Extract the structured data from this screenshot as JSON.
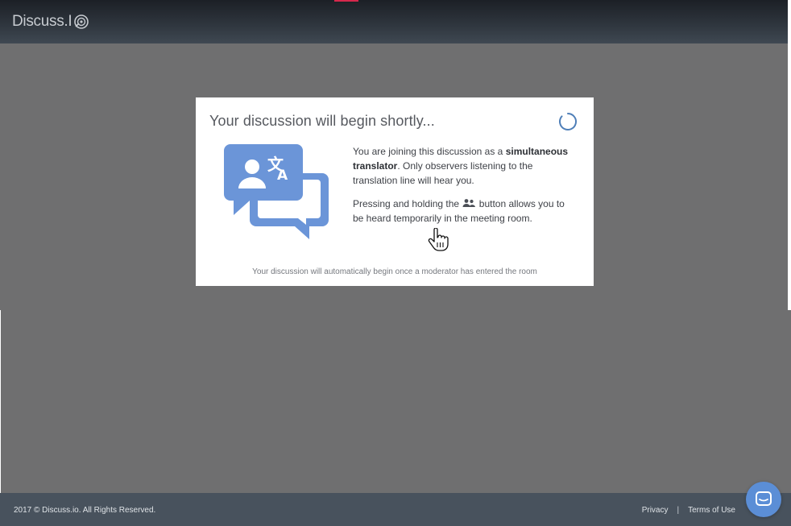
{
  "header": {
    "logo_text": "Discuss.I",
    "logo_icon": "discuss-logo-icon"
  },
  "modal": {
    "title": "Your discussion will begin shortly...",
    "spinner_icon": "loading-spinner-icon",
    "illustration_icon": "translation-chat-bubbles-icon",
    "paragraph1_prefix": "You are joining this discussion as a",
    "paragraph1_bold": "simultaneous translator",
    "paragraph1_suffix": ". Only observers listening to the translation line will hear you.",
    "paragraph2_prefix": "Pressing and holding the",
    "paragraph2_icon": "group-speak-icon",
    "paragraph2_suffix": "button allows you to be heard temporarily in the meeting room.",
    "footer_note": "Your discussion will automatically begin once a moderator has entered the room"
  },
  "footer": {
    "copyright": "2017 © Discuss.io. All Rights Reserved.",
    "privacy": "Privacy",
    "separator": "|",
    "terms": "Terms of Use"
  },
  "chat_launcher": {
    "icon": "chat-bubble-icon"
  },
  "colors": {
    "brand_blue": "#5b8ed6",
    "illustration_blue": "#6b95d8",
    "header_dark": "#2e353d",
    "footer_bg": "#48525d",
    "overlay_gray": "#6f6f70",
    "accent_red": "#d6284c"
  }
}
